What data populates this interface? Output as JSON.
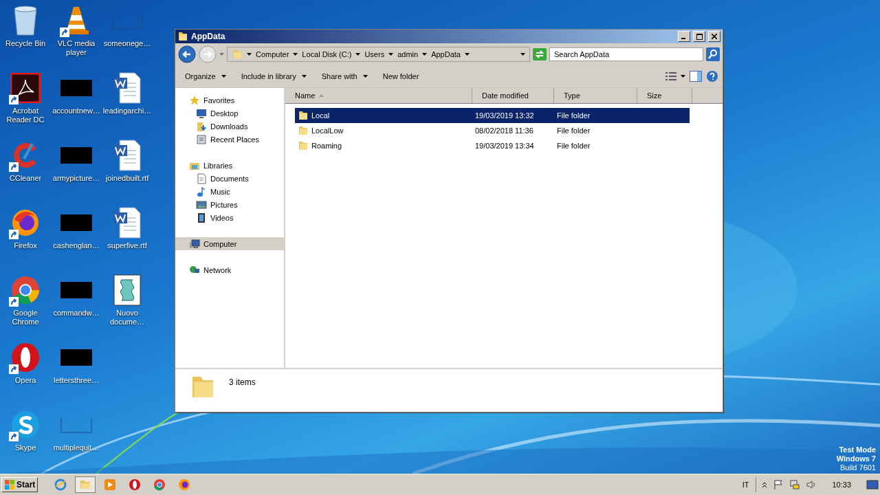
{
  "desktop_icons": [
    {
      "label": "Recycle Bin",
      "kind": "recycle",
      "shortcut": false
    },
    {
      "label": "Acrobat Reader DC",
      "kind": "acrobat",
      "shortcut": true
    },
    {
      "label": "CCleaner",
      "kind": "ccleaner",
      "shortcut": true
    },
    {
      "label": "Firefox",
      "kind": "firefox",
      "shortcut": true
    },
    {
      "label": "Google Chrome",
      "kind": "chrome",
      "shortcut": true
    },
    {
      "label": "Opera",
      "kind": "opera",
      "shortcut": true
    },
    {
      "label": "Skype",
      "kind": "skype",
      "shortcut": true
    },
    {
      "label": "VLC media player",
      "kind": "vlc",
      "shortcut": true
    },
    {
      "label": "accountnew…",
      "kind": "thumb",
      "shortcut": false
    },
    {
      "label": "armypicture…",
      "kind": "thumb",
      "shortcut": false
    },
    {
      "label": "cashenglan…",
      "kind": "thumb",
      "shortcut": false
    },
    {
      "label": "commandw…",
      "kind": "thumb",
      "shortcut": false
    },
    {
      "label": "lettersthree…",
      "kind": "thumb",
      "shortcut": false
    },
    {
      "label": "multiplequit…",
      "kind": "blank",
      "shortcut": false
    },
    {
      "label": "someonege…",
      "kind": "blank",
      "shortcut": false
    },
    {
      "label": "leadingarchi…",
      "kind": "word",
      "shortcut": false
    },
    {
      "label": "joinedbuilt.rtf",
      "kind": "word",
      "shortcut": false
    },
    {
      "label": "superfive.rtf",
      "kind": "word",
      "shortcut": false
    },
    {
      "label": "Nuovo docume…",
      "kind": "script",
      "shortcut": false
    }
  ],
  "watermark_text": [
    "Test Mode",
    "Windows 7",
    "Build 7601"
  ],
  "window": {
    "title": "AppData",
    "breadcrumbs": [
      "Computer",
      "Local Disk (C:)",
      "Users",
      "admin",
      "AppData"
    ],
    "search": {
      "placeholder": "Search AppData"
    },
    "toolbar": [
      {
        "label": "Organize",
        "has_menu": true
      },
      {
        "label": "Include in library",
        "has_menu": true
      },
      {
        "label": "Share with",
        "has_menu": true
      },
      {
        "label": "New folder",
        "has_menu": false
      }
    ],
    "nav": [
      {
        "label": "Favorites",
        "kind": "favorites",
        "selected": false,
        "children": [
          {
            "label": "Desktop",
            "kind": "desktop",
            "selected": false
          },
          {
            "label": "Downloads",
            "kind": "downloads",
            "selected": false
          },
          {
            "label": "Recent Places",
            "kind": "recent",
            "selected": false
          }
        ]
      },
      {
        "label": "Libraries",
        "kind": "libraries",
        "selected": false,
        "children": [
          {
            "label": "Documents",
            "kind": "documents",
            "selected": false
          },
          {
            "label": "Music",
            "kind": "music",
            "selected": false
          },
          {
            "label": "Pictures",
            "kind": "pictures",
            "selected": false
          },
          {
            "label": "Videos",
            "kind": "videos",
            "selected": false
          }
        ]
      },
      {
        "label": "Computer",
        "kind": "computer",
        "selected": true
      },
      {
        "label": "Network",
        "kind": "network",
        "selected": false
      }
    ],
    "columns": [
      {
        "label": "Name",
        "sorted": true
      },
      {
        "label": "Date modified",
        "sorted": false
      },
      {
        "label": "Type",
        "sorted": false
      },
      {
        "label": "Size",
        "sorted": false
      }
    ],
    "files": [
      {
        "name": "Local",
        "date": "19/03/2019 13:32",
        "type": "File folder",
        "selected": true
      },
      {
        "name": "LocalLow",
        "date": "08/02/2018 11:36",
        "type": "File folder",
        "selected": false
      },
      {
        "name": "Roaming",
        "date": "19/03/2019 13:34",
        "type": "File folder",
        "selected": false
      }
    ],
    "status": "3 items"
  },
  "taskbar": {
    "start": "Start",
    "apps": [
      {
        "kind": "ie",
        "active": false
      },
      {
        "kind": "explorer",
        "active": true
      },
      {
        "kind": "media",
        "active": false
      },
      {
        "kind": "opera",
        "active": false
      },
      {
        "kind": "chrome",
        "active": false
      },
      {
        "kind": "firefox",
        "active": false
      }
    ],
    "language": "IT",
    "clock": "10:33"
  }
}
